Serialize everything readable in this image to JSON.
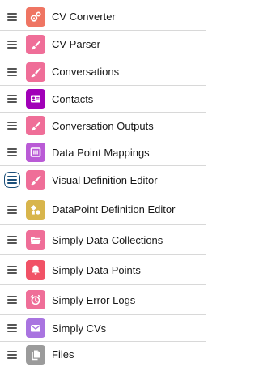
{
  "colors": {
    "pink": "#ef6e98",
    "salmon": "#ef7563",
    "purple": "#a100b8",
    "violet": "#ba5bd6",
    "mustard": "#d8b54c",
    "red": "#f15266",
    "lavender": "#a974e0",
    "gray": "#9b9b9b",
    "focus_ring": "#1b4f7a"
  },
  "items": [
    {
      "label": "CV Converter",
      "icon": "gears-icon"
    },
    {
      "label": "CV Parser",
      "icon": "brush-icon"
    },
    {
      "label": "Conversations",
      "icon": "brush-icon"
    },
    {
      "label": "Contacts",
      "icon": "contact-card-icon"
    },
    {
      "label": "Conversation Outputs",
      "icon": "brush-icon"
    },
    {
      "label": "Data Point Mappings",
      "icon": "columns-icon"
    },
    {
      "label": "Visual Definition Editor",
      "icon": "brush-icon"
    },
    {
      "label": "DataPoint Definition Editor",
      "icon": "shapes-icon"
    },
    {
      "label": "Simply Data Collections",
      "icon": "folder-open-icon"
    },
    {
      "label": "Simply Data Points",
      "icon": "bell-icon"
    },
    {
      "label": "Simply Error Logs",
      "icon": "alarm-clock-icon"
    },
    {
      "label": "Simply CVs",
      "icon": "envelope-icon"
    },
    {
      "label": "Files",
      "icon": "document-copy-icon"
    }
  ]
}
